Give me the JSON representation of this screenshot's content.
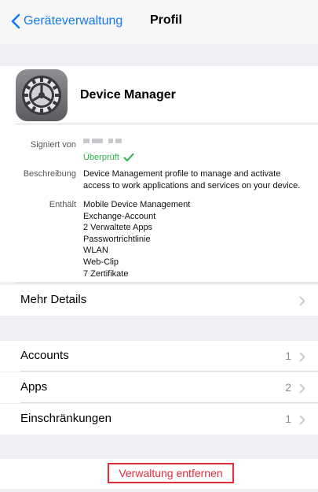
{
  "navbar": {
    "back_label": "Geräteverwaltung",
    "title": "Profil"
  },
  "profile": {
    "name": "Device Manager",
    "icon": "settings-gear-icon"
  },
  "details": {
    "signed_by_label": "Signiert von",
    "verified_label": "Überprüft",
    "description_label": "Beschreibung",
    "description_lines": [
      "Device Management profile to manage and activate",
      "access to work applications and services on your device."
    ],
    "contains_label": "Enthält",
    "contains_items": [
      "Mobile Device Management",
      "Exchange-Account",
      "2 Verwaltete Apps",
      "Passwortrichtlinie",
      "WLAN",
      "Web-Clip",
      "7 Zertifikate"
    ]
  },
  "more_details": {
    "label": "Mehr Details"
  },
  "list": {
    "accounts": {
      "label": "Accounts",
      "count": "1"
    },
    "apps": {
      "label": "Apps",
      "count": "2"
    },
    "restrictions": {
      "label": "Einschränkungen",
      "count": "1"
    }
  },
  "actions": {
    "remove_label": "Verwaltung entfernen"
  },
  "colors": {
    "accent": "#1478f5",
    "verified": "#2bb24c",
    "destructive": "#e32d3a",
    "background": "#efeff4"
  }
}
